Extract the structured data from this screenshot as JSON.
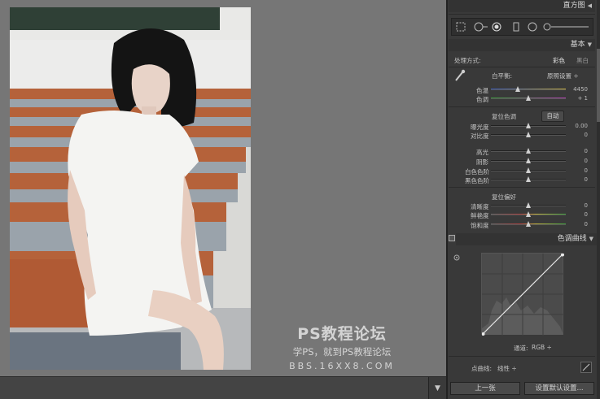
{
  "panel": {
    "histogram_title": "直方图",
    "basic_title": "基本",
    "treatment_label": "处理方式:",
    "treatment_color": "彩色",
    "treatment_bw": "黑白",
    "wb_label": "白平衡:",
    "wb_value": "原照设置 ÷",
    "temp_label": "色温",
    "temp_value": "4450",
    "tint_label": "色调",
    "tint_value": "+ 1",
    "tone_section": "复位色调",
    "auto_label": "自动",
    "exposure_label": "曝光度",
    "exposure_value": "0.00",
    "contrast_label": "对比度",
    "contrast_value": "0",
    "highlights_label": "高光",
    "highlights_value": "0",
    "shadows_label": "阴影",
    "shadows_value": "0",
    "whites_label": "白色色阶",
    "whites_value": "0",
    "blacks_label": "黑色色阶",
    "blacks_value": "0",
    "presence_section": "复位偏好",
    "clarity_label": "清晰度",
    "clarity_value": "0",
    "vibrance_label": "鲜艳度",
    "vibrance_value": "0",
    "saturation_label": "饱和度",
    "saturation_value": "0",
    "tone_curve_title": "色调曲线",
    "channel_label": "通道:",
    "channel_value": "RGB ÷",
    "point_curve_label": "点曲线:",
    "point_curve_value": "线性 ÷",
    "prev_button": "上一张",
    "reset_button": "设置默认设置..."
  },
  "slider_levels": {
    "temp": 0.36,
    "tint": 0.5,
    "exposure": 0.5,
    "contrast": 0.5,
    "highlights": 0.5,
    "shadows": 0.5,
    "whites": 0.5,
    "blacks": 0.5,
    "clarity": 0.5,
    "vibrance": 0.5,
    "saturation": 0.5
  },
  "watermark": {
    "line1": "PS教程论坛",
    "line2": "学PS，就到PS教程论坛",
    "line3": "BBS.16XX8.COM"
  },
  "colors": {
    "panel_bg": "#393939",
    "canvas_bg": "#767676",
    "header_bg": "#333333"
  }
}
